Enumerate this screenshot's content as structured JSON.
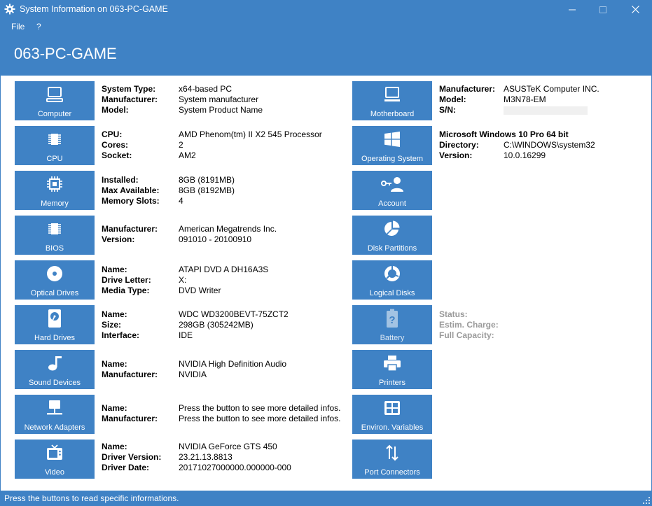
{
  "window": {
    "title": "System Information on 063-PC-GAME",
    "icon": "gear-icon"
  },
  "menu": {
    "file": "File",
    "help": "?"
  },
  "header": {
    "hostname": "063-PC-GAME"
  },
  "left": [
    {
      "label": "Computer",
      "icon": "computer-icon",
      "rows": [
        {
          "k": "System Type:",
          "v": "x64-based PC"
        },
        {
          "k": "Manufacturer:",
          "v": "System manufacturer"
        },
        {
          "k": "Model:",
          "v": "System Product Name"
        }
      ]
    },
    {
      "label": "CPU",
      "icon": "cpu-icon",
      "rows": [
        {
          "k": "CPU:",
          "v": "AMD Phenom(tm) II X2 545 Processor"
        },
        {
          "k": "Cores:",
          "v": "2"
        },
        {
          "k": "Socket:",
          "v": "AM2"
        }
      ]
    },
    {
      "label": "Memory",
      "icon": "memory-icon",
      "rows": [
        {
          "k": "Installed:",
          "v": "8GB (8191MB)"
        },
        {
          "k": "Max Available:",
          "v": "8GB (8192MB)"
        },
        {
          "k": "Memory Slots:",
          "v": "4"
        }
      ]
    },
    {
      "label": "BIOS",
      "icon": "bios-chip-icon",
      "rows": [
        {
          "k": "Manufacturer:",
          "v": "American Megatrends Inc."
        },
        {
          "k": "Version:",
          "v": "091010 - 20100910"
        }
      ]
    },
    {
      "label": "Optical Drives",
      "icon": "disc-icon",
      "rows": [
        {
          "k": "Name:",
          "v": "ATAPI DVD A  DH16A3S"
        },
        {
          "k": "Drive Letter:",
          "v": "X:"
        },
        {
          "k": "Media Type:",
          "v": "DVD Writer"
        }
      ]
    },
    {
      "label": "Hard Drives",
      "icon": "hard-drive-icon",
      "rows": [
        {
          "k": "Name:",
          "v": "WDC WD3200BEVT-75ZCT2"
        },
        {
          "k": "Size:",
          "v": "298GB (305242MB)"
        },
        {
          "k": "Interface:",
          "v": "IDE"
        }
      ]
    },
    {
      "label": "Sound Devices",
      "icon": "music-note-icon",
      "rows": [
        {
          "k": "Name:",
          "v": "NVIDIA High Definition Audio"
        },
        {
          "k": "Manufacturer:",
          "v": "NVIDIA"
        }
      ]
    },
    {
      "label": "Network Adapters",
      "icon": "network-icon",
      "rows": [
        {
          "k": "Name:",
          "v": "Press the button to see more detailed infos."
        },
        {
          "k": "Manufacturer:",
          "v": "Press the button to see more detailed infos."
        }
      ]
    },
    {
      "label": "Video",
      "icon": "tv-icon",
      "rows": [
        {
          "k": "Name:",
          "v": "NVIDIA GeForce GTS 450"
        },
        {
          "k": "Driver Version:",
          "v": "23.21.13.8813"
        },
        {
          "k": "Driver Date:",
          "v": "20171027000000.000000-000"
        }
      ]
    }
  ],
  "right": [
    {
      "label": "Motherboard",
      "icon": "monitor-icon",
      "rows": [
        {
          "k": "Manufacturer:",
          "v": "ASUSTeK Computer INC."
        },
        {
          "k": "Model:",
          "v": "M3N78-EM"
        },
        {
          "k": "S/N:",
          "v": ""
        }
      ]
    },
    {
      "label": "Operating System",
      "icon": "windows-logo-icon",
      "rows": [
        {
          "k": "Microsoft Windows 10 Pro 64 bit",
          "v": ""
        },
        {
          "k": "Directory:",
          "v": "C:\\WINDOWS\\system32"
        },
        {
          "k": "Version:",
          "v": "10.0.16299"
        }
      ]
    },
    {
      "label": "Account",
      "icon": "user-key-icon",
      "rows": []
    },
    {
      "label": "Disk Partitions",
      "icon": "pie-chart-icon",
      "rows": []
    },
    {
      "label": "Logical Disks",
      "icon": "donut-chart-icon",
      "rows": []
    },
    {
      "label": "Battery",
      "icon": "battery-unknown-icon",
      "rows": [
        {
          "k": "Status:",
          "v": ""
        },
        {
          "k": "Estim. Charge:",
          "v": ""
        },
        {
          "k": "Full Capacity:",
          "v": ""
        }
      ]
    },
    {
      "label": "Printers",
      "icon": "printer-icon",
      "rows": []
    },
    {
      "label": "Environ. Variables",
      "icon": "grid-icon",
      "rows": []
    },
    {
      "label": "Port Connectors",
      "icon": "arrows-updown-icon",
      "rows": []
    }
  ],
  "status": {
    "text": "Press the buttons to read specific informations."
  },
  "colors": {
    "accent": "#3f82c5",
    "disabled_text": "#9a9a9a"
  }
}
